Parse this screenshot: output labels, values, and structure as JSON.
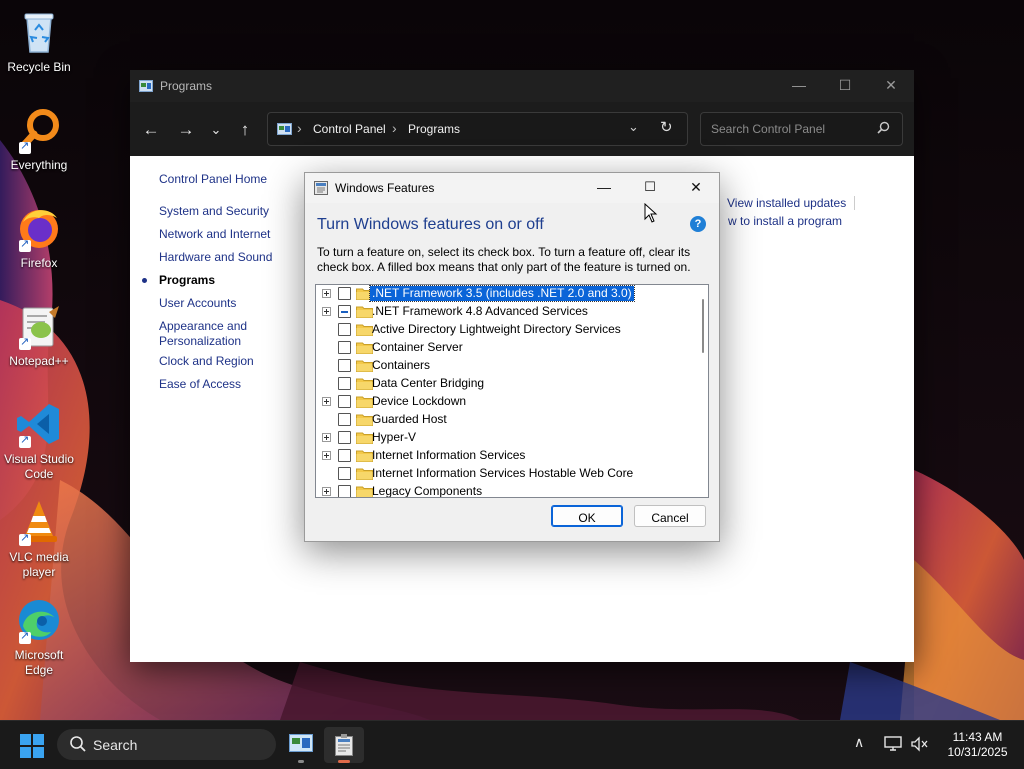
{
  "desktop": {
    "icons": [
      {
        "label": "Recycle Bin",
        "icon": "recycle-bin-icon"
      },
      {
        "label": "Everything",
        "icon": "everything-search-icon"
      },
      {
        "label": "Firefox",
        "icon": "firefox-icon"
      },
      {
        "label": "Notepad++",
        "icon": "notepad-plus-plus-icon"
      },
      {
        "label": "Visual Studio Code",
        "icon": "vscode-icon"
      },
      {
        "label": "VLC media player",
        "icon": "vlc-icon"
      },
      {
        "label": "Microsoft Edge",
        "icon": "edge-icon"
      }
    ]
  },
  "control_panel": {
    "title": "Programs",
    "breadcrumbs": [
      "Control Panel",
      "Programs"
    ],
    "search_placeholder": "Search Control Panel",
    "nav_links": [
      {
        "label": "Control Panel Home"
      },
      {
        "label": "System and Security"
      },
      {
        "label": "Network and Internet"
      },
      {
        "label": "Hardware and Sound"
      },
      {
        "label": "Programs",
        "current": true
      },
      {
        "label": "User Accounts"
      },
      {
        "label": "Appearance and Personalization"
      },
      {
        "label": "Clock and Region"
      },
      {
        "label": "Ease of Access"
      }
    ],
    "content_links": {
      "view_installed_updates": "View installed updates",
      "how_to_install": "w to install a program"
    }
  },
  "features_dialog": {
    "title": "Windows Features",
    "heading": "Turn Windows features on or off",
    "help_glyph": "?",
    "description": "To turn a feature on, select its check box. To turn a feature off, clear its check box. A filled box means that only part of the feature is turned on.",
    "features": [
      {
        "label": ".NET Framework 3.5 (includes .NET 2.0 and 3.0)",
        "expandable": true,
        "state": "unchecked",
        "selected": true
      },
      {
        "label": ".NET Framework 4.8 Advanced Services",
        "expandable": true,
        "state": "partial",
        "selected": false
      },
      {
        "label": "Active Directory Lightweight Directory Services",
        "expandable": false,
        "state": "unchecked",
        "selected": false
      },
      {
        "label": "Container Server",
        "expandable": false,
        "state": "unchecked",
        "selected": false
      },
      {
        "label": "Containers",
        "expandable": false,
        "state": "unchecked",
        "selected": false
      },
      {
        "label": "Data Center Bridging",
        "expandable": false,
        "state": "unchecked",
        "selected": false
      },
      {
        "label": "Device Lockdown",
        "expandable": true,
        "state": "unchecked",
        "selected": false
      },
      {
        "label": "Guarded Host",
        "expandable": false,
        "state": "unchecked",
        "selected": false
      },
      {
        "label": "Hyper-V",
        "expandable": true,
        "state": "unchecked",
        "selected": false
      },
      {
        "label": "Internet Information Services",
        "expandable": true,
        "state": "unchecked",
        "selected": false
      },
      {
        "label": "Internet Information Services Hostable Web Core",
        "expandable": false,
        "state": "unchecked",
        "selected": false
      },
      {
        "label": "Legacy Components",
        "expandable": true,
        "state": "unchecked",
        "selected": false
      }
    ],
    "ok_label": "OK",
    "cancel_label": "Cancel"
  },
  "taskbar": {
    "search_label": "Search",
    "time": "11:43 AM",
    "date": "10/31/2025",
    "apps": [
      {
        "name": "control-panel-taskbar-app",
        "active": false
      },
      {
        "name": "windows-features-taskbar-app",
        "active": true
      }
    ]
  },
  "colors": {
    "link": "#1e3287",
    "heading": "#1f3f8f",
    "selection": "#0a64d8",
    "taskbar": "#1a1a1a",
    "titlebar_dark": "#202020"
  }
}
